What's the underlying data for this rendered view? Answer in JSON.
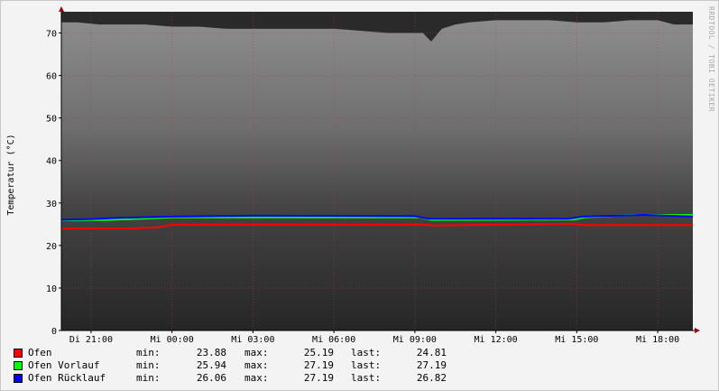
{
  "window": {
    "watermark": "RRDTOOL / TOBI OETIKER"
  },
  "chart_data": {
    "type": "line",
    "ylabel": "Temperatur (°C)",
    "ylim": [
      0,
      75
    ],
    "yticks": [
      0,
      10,
      20,
      30,
      40,
      50,
      60,
      70
    ],
    "x_tick_labels": [
      "Di 21:00",
      "Mi 00:00",
      "Mi 03:00",
      "Mi 06:00",
      "Mi 09:00",
      "Mi 12:00",
      "Mi 15:00",
      "Mi 18:00"
    ],
    "x_tick_hours": [
      21,
      24,
      27,
      30,
      33,
      36,
      39,
      42
    ],
    "x_range_hours": [
      19.9,
      43.3
    ],
    "grid": true,
    "background_band": {
      "x_hours": [
        19.9,
        20.5,
        21.3,
        22,
        23,
        24,
        25,
        26,
        27,
        28,
        29,
        30,
        31,
        32,
        33.3,
        33.6,
        34,
        34.5,
        35,
        36,
        37,
        38,
        39,
        40,
        41,
        42,
        42.6,
        43.3
      ],
      "top": [
        72.5,
        72.5,
        72,
        72,
        72,
        71.5,
        71.5,
        71,
        71,
        71,
        71,
        71,
        70.5,
        70,
        70,
        68,
        71,
        72,
        72.5,
        73,
        73,
        73,
        72.5,
        72.5,
        73,
        73,
        72,
        72
      ]
    },
    "series": [
      {
        "name": "Ofen",
        "color": "#ff0000",
        "x": [
          19.9,
          20.2,
          22.5,
          23.5,
          24,
          33.3,
          33.7,
          38.8,
          39.3,
          43.3
        ],
        "values": [
          23.88,
          24.0,
          24.0,
          24.3,
          24.9,
          24.9,
          24.7,
          25.1,
          24.8,
          24.81
        ]
      },
      {
        "name": "Ofen Vorlauf",
        "color": "#00ff00",
        "x": [
          19.9,
          21.5,
          22.5,
          23.3,
          24,
          33.2,
          33.6,
          38.9,
          39.3,
          41,
          43.3
        ],
        "values": [
          25.94,
          26.0,
          26.2,
          26.4,
          26.6,
          26.6,
          26.0,
          26.1,
          26.6,
          27.19,
          27.19
        ]
      },
      {
        "name": "Ofen Rücklauf",
        "color": "#0000ff",
        "x": [
          19.9,
          21,
          22,
          24,
          27,
          33,
          33.5,
          38.7,
          39.2,
          41.5,
          43.3
        ],
        "values": [
          26.06,
          26.2,
          26.5,
          26.8,
          27.0,
          26.9,
          26.3,
          26.3,
          26.8,
          27.19,
          26.82
        ]
      }
    ]
  },
  "legend": {
    "min_label": "min:",
    "max_label": "max:",
    "last_label": "last:",
    "rows": [
      {
        "name": "Ofen",
        "color": "#ff0000",
        "min": "23.88",
        "max": "25.19",
        "last": "24.81"
      },
      {
        "name": "Ofen Vorlauf",
        "color": "#00ff00",
        "min": "25.94",
        "max": "27.19",
        "last": "27.19"
      },
      {
        "name": "Ofen Rücklauf",
        "color": "#0000ff",
        "min": "26.06",
        "max": "27.19",
        "last": "26.82"
      }
    ]
  }
}
